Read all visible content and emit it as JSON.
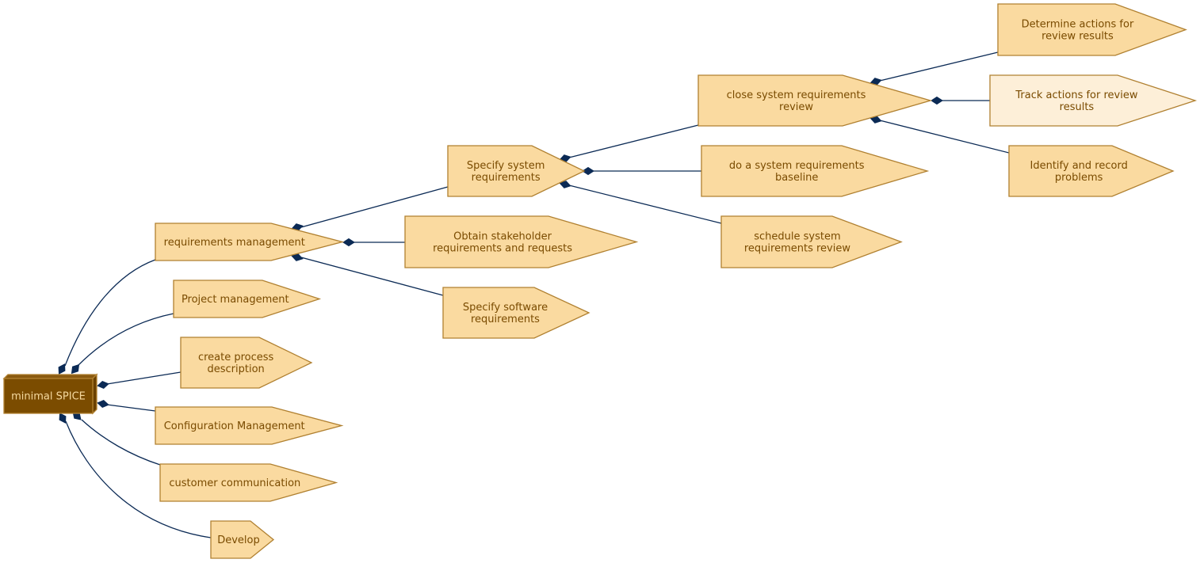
{
  "diagram": {
    "title": "minimal SPICE",
    "colors": {
      "node_fill": "#fadaa0",
      "node_fill_highlight": "#fdefd8",
      "node_stroke": "#b08030",
      "root_fill": "#7b4c00",
      "root_label": "#f5d9a0",
      "label": "#7a4b00",
      "edge": "#0b2a55"
    },
    "root": {
      "id": "root",
      "label": [
        "minimal SPICE"
      ]
    },
    "nodes": [
      {
        "id": "req-mgmt",
        "parent": "root",
        "label": [
          "requirements management"
        ]
      },
      {
        "id": "proj-mgmt",
        "parent": "root",
        "label": [
          "Project management"
        ]
      },
      {
        "id": "create-process",
        "parent": "root",
        "label": [
          "create process",
          "description"
        ]
      },
      {
        "id": "config-mgmt",
        "parent": "root",
        "label": [
          "Configuration Management"
        ]
      },
      {
        "id": "customer-comm",
        "parent": "root",
        "label": [
          "customer communication"
        ]
      },
      {
        "id": "develop",
        "parent": "root",
        "label": [
          "Develop"
        ]
      },
      {
        "id": "spec-sys",
        "parent": "req-mgmt",
        "label": [
          "Specify system",
          "requirements"
        ]
      },
      {
        "id": "obtain-stake",
        "parent": "req-mgmt",
        "label": [
          "Obtain stakeholder",
          "requirements and requests"
        ]
      },
      {
        "id": "spec-sw",
        "parent": "req-mgmt",
        "label": [
          "Specify software",
          "requirements"
        ]
      },
      {
        "id": "close-review",
        "parent": "spec-sys",
        "label": [
          "close system requirements",
          "review"
        ]
      },
      {
        "id": "baseline",
        "parent": "spec-sys",
        "label": [
          "do a system requirements",
          "baseline"
        ]
      },
      {
        "id": "schedule-review",
        "parent": "spec-sys",
        "label": [
          "schedule system",
          "requirements review"
        ]
      },
      {
        "id": "determine-actions",
        "parent": "close-review",
        "label": [
          "Determine actions for",
          "review results"
        ]
      },
      {
        "id": "track-actions",
        "parent": "close-review",
        "label": [
          "Track actions for review",
          "results"
        ],
        "highlight": true
      },
      {
        "id": "identify-problems",
        "parent": "close-review",
        "label": [
          "Identify and record",
          "problems"
        ]
      }
    ]
  }
}
